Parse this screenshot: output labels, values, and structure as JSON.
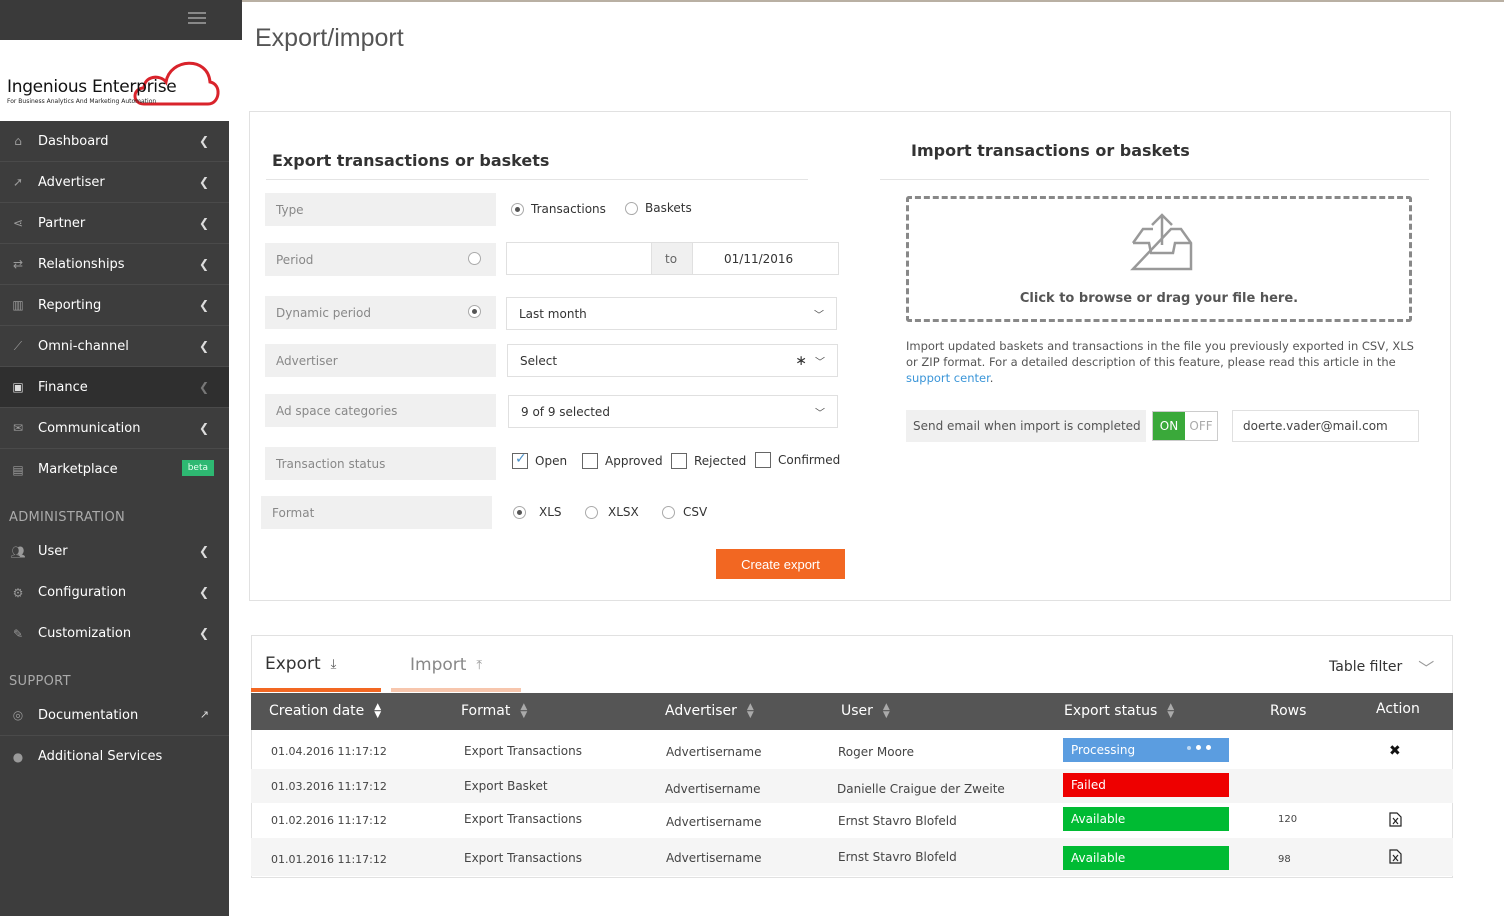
{
  "page": {
    "title": "Export/import"
  },
  "sidebar": {
    "logo_text": "Ingenious Enterprise",
    "logo_tagline": "For Business Analytics And Marketing Automation",
    "items": [
      {
        "label": "Dashboard",
        "icon": "home-icon"
      },
      {
        "label": "Advertiser",
        "icon": "rocket-icon"
      },
      {
        "label": "Partner",
        "icon": "share-icon"
      },
      {
        "label": "Relationships",
        "icon": "exchange-icon"
      },
      {
        "label": "Reporting",
        "icon": "bar-chart-icon"
      },
      {
        "label": "Omni-channel",
        "icon": "line-chart-icon"
      },
      {
        "label": "Finance",
        "icon": "money-icon"
      },
      {
        "label": "Communication",
        "icon": "envelope-icon"
      },
      {
        "label": "Marketplace",
        "icon": "briefcase-icon",
        "badge": "beta"
      }
    ],
    "admin_title": "ADMINISTRATION",
    "admin_items": [
      {
        "label": "User",
        "icon": "users-icon"
      },
      {
        "label": "Configuration",
        "icon": "gears-icon"
      },
      {
        "label": "Customization",
        "icon": "brush-icon"
      }
    ],
    "support_title": "SUPPORT",
    "support_items": [
      {
        "label": "Documentation",
        "icon": "life-ring-icon"
      },
      {
        "label": "Additional Services",
        "icon": "user-icon"
      }
    ]
  },
  "export": {
    "title": "Export transactions or baskets",
    "type_label": "Type",
    "type_options": [
      "Transactions",
      "Baskets"
    ],
    "period_label": "Period",
    "period_to": "to",
    "period_end": "01/11/2016",
    "dynamic_label": "Dynamic period",
    "dynamic_value": "Last month",
    "advertiser_label": "Advertiser",
    "advertiser_value": "Select",
    "adspace_label": "Ad space categories",
    "adspace_value": "9 of 9 selected",
    "status_label": "Transaction status",
    "status_options": [
      "Open",
      "Approved",
      "Rejected",
      "Confirmed"
    ],
    "format_label": "Format",
    "format_options": [
      "XLS",
      "XLSX",
      "CSV"
    ],
    "create_button": "Create export"
  },
  "import": {
    "title": "Import transactions or baskets",
    "dropzone_text": "Click to browse or drag your file here.",
    "description": "Import updated baskets and transactions in the file you previously exported in CSV, XLS or ZIP format. For a detailed description of this feature, please read this article in the",
    "link_text": "support center",
    "link_suffix": ".",
    "email_label": "Send email when import is completed",
    "toggle_on": "ON",
    "toggle_off": "OFF",
    "email_value": "doerte.vader@mail.com"
  },
  "table": {
    "tab_export": "Export",
    "tab_import": "Import",
    "filter_label": "Table filter",
    "columns": [
      "Creation date",
      "Format",
      "Advertiser",
      "User",
      "Export status",
      "Rows",
      "Action"
    ],
    "rows": [
      {
        "date": "01.04.2016 11:17:12",
        "format": "Export Transactions",
        "advertiser": "Advertisername",
        "user": "Roger Moore",
        "status": "Processing",
        "rows": "",
        "action": "close-icon"
      },
      {
        "date": "01.03.2016 11:17:12",
        "format": "Export Basket",
        "advertiser": "Advertisername",
        "user": "Danielle Craigue der Zweite",
        "status": "Failed",
        "rows": "",
        "action": ""
      },
      {
        "date": "01.02.2016 11:17:12",
        "format": "Export Transactions",
        "advertiser": "Advertisername",
        "user": "Ernst Stavro Blofeld",
        "status": "Available",
        "rows": "120",
        "action": "excel-file-icon"
      },
      {
        "date": "01.01.2016 11:17:12",
        "format": "Export Transactions",
        "advertiser": "Advertisername",
        "user": "Ernst Stavro Blofeld",
        "status": "Available",
        "rows": "98",
        "action": "excel-file-icon"
      }
    ]
  },
  "colors": {
    "accent": "#f26722",
    "processing": "#5b9de0",
    "failed": "#ee0000",
    "available": "#00bb33",
    "toggle_on": "#3aa93a",
    "link": "#3a95d8"
  }
}
